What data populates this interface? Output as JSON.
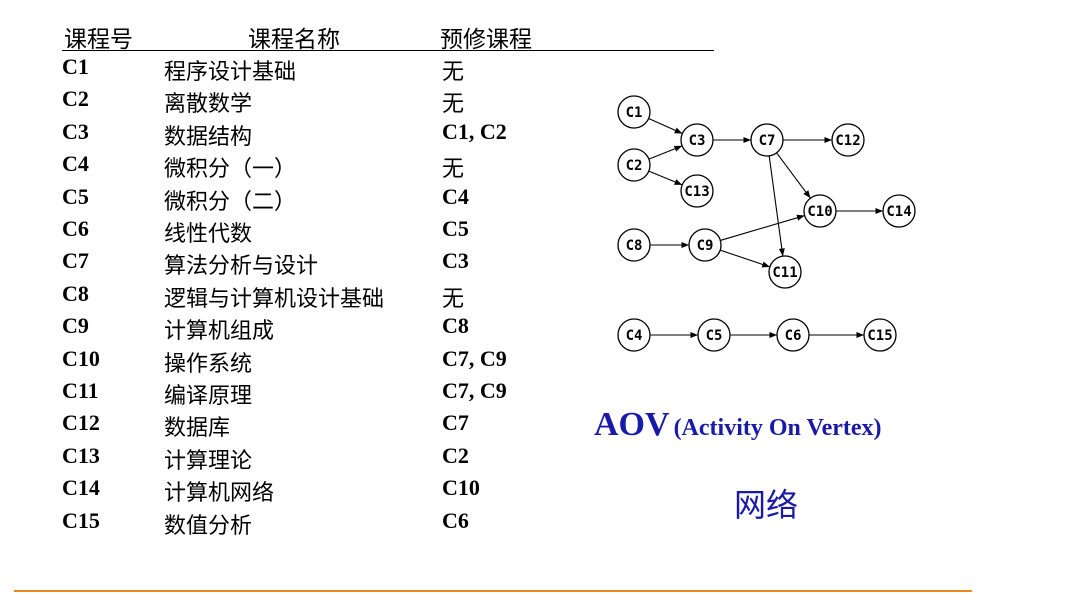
{
  "table": {
    "headers": {
      "id": "课程号",
      "name": "课程名称",
      "prereq": "预修课程"
    },
    "rows": [
      {
        "id": "C1",
        "name": "程序设计基础",
        "prereq": "无"
      },
      {
        "id": "C2",
        "name": "离散数学",
        "prereq": "无"
      },
      {
        "id": "C3",
        "name": "数据结构",
        "prereq": "C1, C2"
      },
      {
        "id": "C4",
        "name": "微积分（一）",
        "prereq": "无"
      },
      {
        "id": "C5",
        "name": "微积分（二）",
        "prereq": "C4"
      },
      {
        "id": "C6",
        "name": "线性代数",
        "prereq": "C5"
      },
      {
        "id": "C7",
        "name": "算法分析与设计",
        "prereq": "C3"
      },
      {
        "id": "C8",
        "name": "逻辑与计算机设计基础",
        "prereq": "无"
      },
      {
        "id": "C9",
        "name": "计算机组成",
        "prereq": "C8"
      },
      {
        "id": "C10",
        "name": "操作系统",
        "prereq": "C7, C9"
      },
      {
        "id": "C11",
        "name": "编译原理",
        "prereq": "C7, C9"
      },
      {
        "id": "C12",
        "name": "数据库",
        "prereq": "C7"
      },
      {
        "id": "C13",
        "name": "计算理论",
        "prereq": "C2"
      },
      {
        "id": "C14",
        "name": "计算机网络",
        "prereq": "C10"
      },
      {
        "id": "C15",
        "name": "数值分析",
        "prereq": "C6"
      }
    ]
  },
  "graph": {
    "nodes": [
      "C1",
      "C2",
      "C3",
      "C7",
      "C12",
      "C13",
      "C10",
      "C14",
      "C8",
      "C9",
      "C11",
      "C4",
      "C5",
      "C6",
      "C15"
    ],
    "edges": [
      [
        "C1",
        "C3"
      ],
      [
        "C2",
        "C3"
      ],
      [
        "C2",
        "C13"
      ],
      [
        "C3",
        "C7"
      ],
      [
        "C7",
        "C12"
      ],
      [
        "C7",
        "C10"
      ],
      [
        "C7",
        "C11"
      ],
      [
        "C10",
        "C14"
      ],
      [
        "C8",
        "C9"
      ],
      [
        "C9",
        "C10"
      ],
      [
        "C9",
        "C11"
      ],
      [
        "C4",
        "C5"
      ],
      [
        "C5",
        "C6"
      ],
      [
        "C6",
        "C15"
      ]
    ]
  },
  "caption": {
    "aov": "AOV",
    "expansion": "(Activity On Vertex)",
    "subtitle": "网络"
  },
  "colors": {
    "caption": "#1a1aa8",
    "rule": "#e8881e"
  }
}
